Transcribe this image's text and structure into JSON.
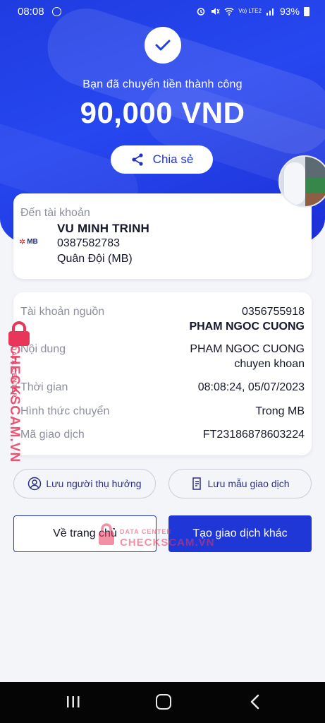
{
  "status_bar": {
    "time": "08:08",
    "network": "Vo) LTE2",
    "battery": "93%"
  },
  "hero": {
    "success_text": "Bạn đã chuyển tiền thành công",
    "amount": "90,000 VND",
    "share_label": "Chia sẻ"
  },
  "recipient": {
    "label": "Đến tài khoản",
    "name": "VU MINH TRINH",
    "account": "0387582783",
    "bank": "Quân Đội (MB)",
    "bank_logo": "MB"
  },
  "details": [
    {
      "key": "Tài khoản nguồn",
      "value": "0356755918",
      "value2": "PHAM NGOC CUONG"
    },
    {
      "key": "Nội dung",
      "value": "PHAM NGOC CUONG",
      "value2": "chuyen khoan"
    },
    {
      "key": "Thời gian",
      "value": "08:08:24, 05/07/2023"
    },
    {
      "key": "Hình thức chuyển",
      "value": "Trong MB"
    },
    {
      "key": "Mã giao dịch",
      "value": "FT23186878603224"
    }
  ],
  "actions": {
    "save_recipient": "Lưu người thụ hưởng",
    "save_template": "Lưu mẫu giao dịch",
    "home": "Về trang chủ",
    "new_transaction": "Tạo giao dịch khác"
  },
  "watermark": {
    "brand": "CHECKSCAM.VN",
    "sub": "DATA CENTER",
    "brand_short": "CHECKSCAM.VN"
  },
  "colors": {
    "primary": "#1f37d6",
    "hero": "#2747f0",
    "watermark": "#e8365b"
  }
}
